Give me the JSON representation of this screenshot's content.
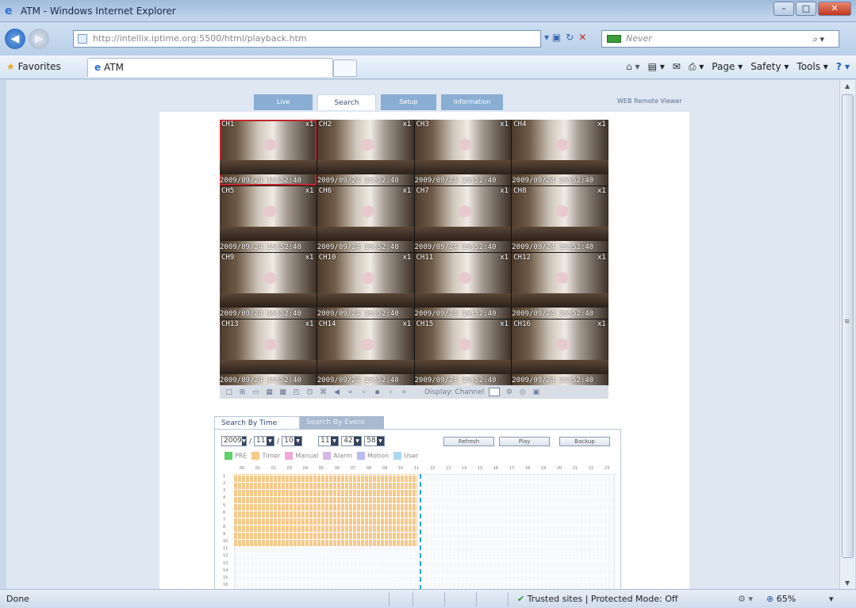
{
  "window": {
    "title": "ATM - Windows Internet Explorer",
    "min_glyph": "–",
    "max_glyph": "□",
    "close_glyph": "✕"
  },
  "address": {
    "url": "http://intellix.iptime.org:5500/html/playback.htm",
    "search_placeholder": "Never"
  },
  "favorites": {
    "label": "Favorites",
    "tab_label": "ATM"
  },
  "commandbar": {
    "page": "Page ▾",
    "safety": "Safety ▾",
    "tools": "Tools ▾"
  },
  "webapp": {
    "tabs": [
      "Live",
      "Search",
      "Setup",
      "Information"
    ],
    "active_tab": "Search",
    "viewer_title": "WEB Remote Viewer",
    "cameras": [
      {
        "label": "CH1",
        "zoom": "x1",
        "timestamp": "2009/09/24 15:52:40",
        "selected": true
      },
      {
        "label": "CH2",
        "zoom": "x1",
        "timestamp": "2009/09/24 15:52:40"
      },
      {
        "label": "CH3",
        "zoom": "x1",
        "timestamp": "2009/09/24 15:52:40"
      },
      {
        "label": "CH4",
        "zoom": "x1",
        "timestamp": "2009/09/24 15:52:40"
      },
      {
        "label": "CH5",
        "zoom": "x1",
        "timestamp": "2009/09/24 15:52:40"
      },
      {
        "label": "CH6",
        "zoom": "x1",
        "timestamp": "2009/09/24 15:52:40"
      },
      {
        "label": "CH7",
        "zoom": "x1",
        "timestamp": "2009/09/24 15:52:40"
      },
      {
        "label": "CH8",
        "zoom": "x1",
        "timestamp": "2009/09/24 15:52:40"
      },
      {
        "label": "CH9",
        "zoom": "x1",
        "timestamp": "2009/09/24 15:52:40"
      },
      {
        "label": "CH10",
        "zoom": "x1",
        "timestamp": "2009/09/24 15:52:40"
      },
      {
        "label": "CH11",
        "zoom": "x1",
        "timestamp": "2009/09/24 15:52:40"
      },
      {
        "label": "CH12",
        "zoom": "x1",
        "timestamp": "2009/09/24 15:52:40"
      },
      {
        "label": "CH13",
        "zoom": "x1",
        "timestamp": "2009/09/24 15:52:40"
      },
      {
        "label": "CH14",
        "zoom": "x1",
        "timestamp": "2009/09/24 15:52:40"
      },
      {
        "label": "CH15",
        "zoom": "x1",
        "timestamp": "2009/09/24 15:52:40"
      },
      {
        "label": "CH16",
        "zoom": "x1",
        "timestamp": "2009/09/24 15:52:40"
      }
    ],
    "controls": {
      "display_label": "Display: Channel"
    },
    "search": {
      "tab_time": "Search By Time",
      "tab_event": "Search By Event",
      "year": "2009",
      "month": "11",
      "day": "10",
      "hour": "11",
      "minute": "42",
      "second": "58",
      "refresh_label": "Refresh",
      "play_label": "Play",
      "backup_label": "Backup",
      "legend": [
        {
          "name": "PRE",
          "color": "#5fd068"
        },
        {
          "name": "Timer",
          "color": "#f6c98a"
        },
        {
          "name": "Manual",
          "color": "#f3a6d8"
        },
        {
          "name": "Alarm",
          "color": "#d8b4f0"
        },
        {
          "name": "Motion",
          "color": "#b7b9f0"
        },
        {
          "name": "User",
          "color": "#a9d8f2"
        }
      ],
      "hours": [
        "00",
        "01",
        "02",
        "03",
        "04",
        "05",
        "06",
        "07",
        "08",
        "09",
        "10",
        "11",
        "12",
        "13",
        "14",
        "15",
        "16",
        "17",
        "18",
        "19",
        "20",
        "21",
        "22",
        "23"
      ],
      "channels": [
        "1",
        "2",
        "3",
        "4",
        "5",
        "6",
        "7",
        "8",
        "9",
        "10",
        "11",
        "12",
        "13",
        "14",
        "15",
        "16"
      ]
    }
  },
  "status": {
    "left": "Done",
    "zone": "Trusted sites | Protected Mode: Off",
    "zoom": "65%"
  }
}
